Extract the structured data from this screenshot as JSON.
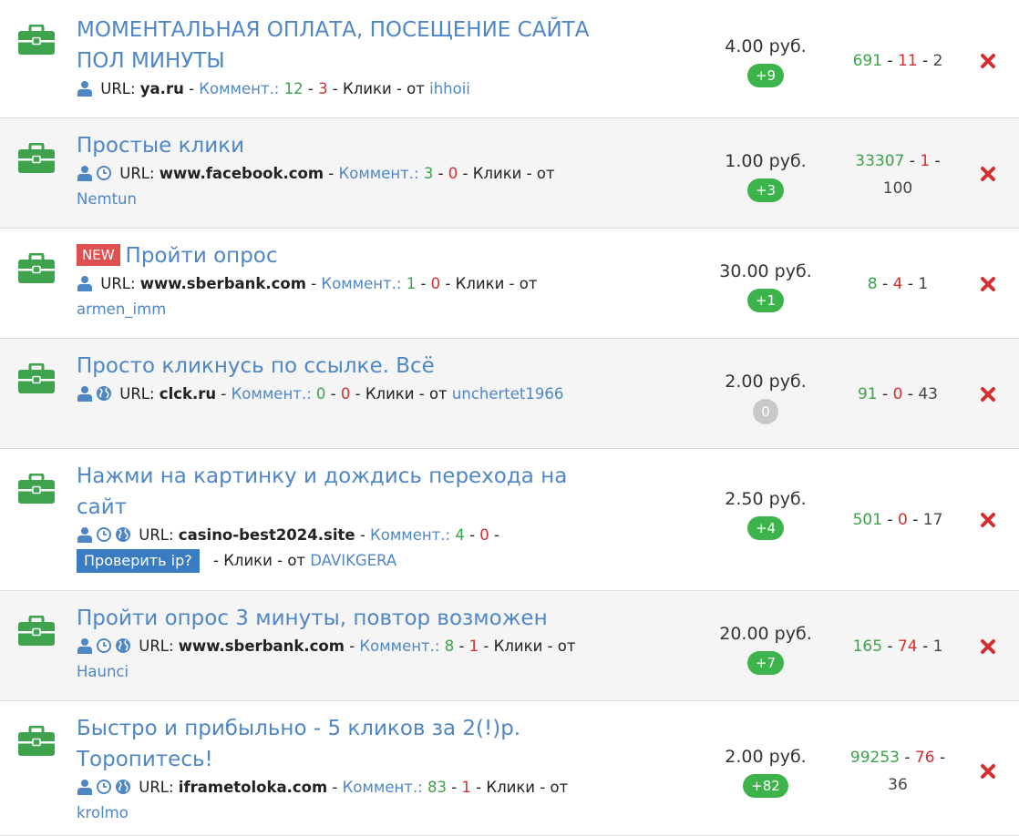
{
  "tasks": [
    {
      "title": "МОМЕНТАЛЬНАЯ ОПЛАТА, ПОСЕЩЕНИЕ САЙТА ПОЛ МИНУТЫ",
      "url_label": "URL:",
      "url": "ya.ru",
      "comments_label": "Коммент.:",
      "comments_pos": "12",
      "comments_neg": "3",
      "clicks_label": "Клики",
      "from_label": "от",
      "author": "ihhoii",
      "price": "4.00 руб.",
      "badge": "+9",
      "stat_green": "691",
      "stat_red": "11",
      "stat_dark": "2"
    },
    {
      "title": "Простые клики",
      "url_label": "URL:",
      "url": "www.facebook.com",
      "comments_label": "Коммент.:",
      "comments_pos": "3",
      "comments_neg": "0",
      "clicks_label": "Клики",
      "from_label": "от",
      "author": "Nemtun",
      "price": "1.00 руб.",
      "badge": "+3",
      "stat_green": "33307",
      "stat_red": "1",
      "stat_dark": "100"
    },
    {
      "new_label": "NEW",
      "title": "Пройти опрос",
      "url_label": "URL:",
      "url": "www.sberbank.com",
      "comments_label": "Коммент.:",
      "comments_pos": "1",
      "comments_neg": "0",
      "clicks_label": "Клики",
      "from_label": "от",
      "author": "armen_imm",
      "price": "30.00 руб.",
      "badge": "+1",
      "stat_green": "8",
      "stat_red": "4",
      "stat_dark": "1"
    },
    {
      "title": "Просто кликнусь по ссылке. Всё",
      "url_label": "URL:",
      "url": "clck.ru",
      "comments_label": "Коммент.:",
      "comments_pos": "0",
      "comments_neg": "0",
      "clicks_label": "Клики",
      "from_label": "от",
      "author": "unchertet1966",
      "price": "2.00 руб.",
      "badge": "0",
      "stat_green": "91",
      "stat_red": "0",
      "stat_dark": "43"
    },
    {
      "title": "Нажми на картинку и дождись перехода на сайт",
      "url_label": "URL:",
      "url": "casino-best2024.site",
      "comments_label": "Коммент.:",
      "comments_pos": "4",
      "comments_neg": "0",
      "check_ip_label": "Проверить ip?",
      "clicks_label": "Клики",
      "from_label": "от",
      "author": "DAVIKGERA",
      "price": "2.50 руб.",
      "badge": "+4",
      "stat_green": "501",
      "stat_red": "0",
      "stat_dark": "17"
    },
    {
      "title": "Пройти опрос 3 минуты, повтор возможен",
      "url_label": "URL:",
      "url": "www.sberbank.com",
      "comments_label": "Коммент.:",
      "comments_pos": "8",
      "comments_neg": "1",
      "clicks_label": "Клики",
      "from_label": "от",
      "author": "Haunci",
      "price": "20.00 руб.",
      "badge": "+7",
      "stat_green": "165",
      "stat_red": "74",
      "stat_dark": "1"
    },
    {
      "title": "Быстро и прибыльно - 5 кликов за 2(!)р. Торопитесь!",
      "url_label": "URL:",
      "url": "iframetoloka.com",
      "comments_label": "Коммент.:",
      "comments_pos": "83",
      "comments_neg": "1",
      "clicks_label": "Клики",
      "from_label": "от",
      "author": "krolmo",
      "price": "2.00 руб.",
      "badge": "+82",
      "stat_green": "99253",
      "stat_red": "76",
      "stat_dark": "36"
    }
  ],
  "icons": {
    "row_icon": "briefcase-icon",
    "user": "user-icon",
    "timer": "clock-icon",
    "web": "globe-icon",
    "delete": "close-icon"
  },
  "colors": {
    "briefcase": "#3fa34d",
    "link": "#4f86c6",
    "green": "#3aa34a",
    "red": "#d42f2f",
    "badge": "#3cb44b",
    "badge_zero": "#c8c8c8",
    "new_badge": "#e05050",
    "check_ip": "#3a7bc2"
  }
}
